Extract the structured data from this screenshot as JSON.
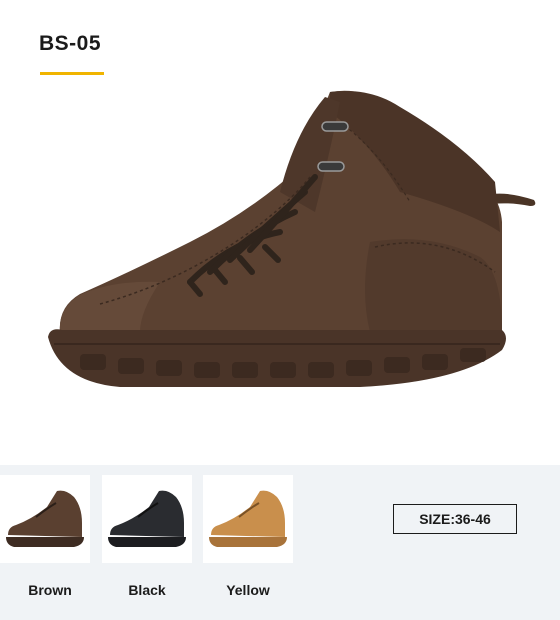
{
  "product": {
    "code": "BS-05",
    "accent_color": "#f0b400"
  },
  "variants": [
    {
      "label": "Brown",
      "color": "#5a4030"
    },
    {
      "label": "Black",
      "color": "#2a2c30"
    },
    {
      "label": "Yellow",
      "color": "#c98f4c"
    }
  ],
  "size": {
    "label": "SIZE:36-46"
  }
}
